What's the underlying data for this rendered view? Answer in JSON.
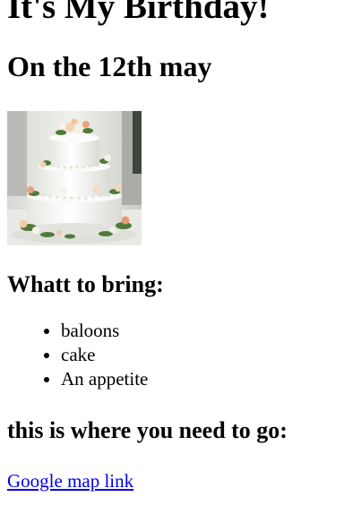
{
  "title": "It's My Birthday!",
  "subtitle": "On the 12th may",
  "image": {
    "alt": "three-tier white wedding cake with flowers"
  },
  "bring": {
    "heading": "Whatt to bring:",
    "items": [
      "baloons",
      "cake",
      "An appetite"
    ]
  },
  "directions": {
    "heading": "this is where you need to go:",
    "link_text": "Google map link"
  },
  "colors": {
    "link": "#0000ee",
    "text": "#000000",
    "background": "#ffffff"
  }
}
